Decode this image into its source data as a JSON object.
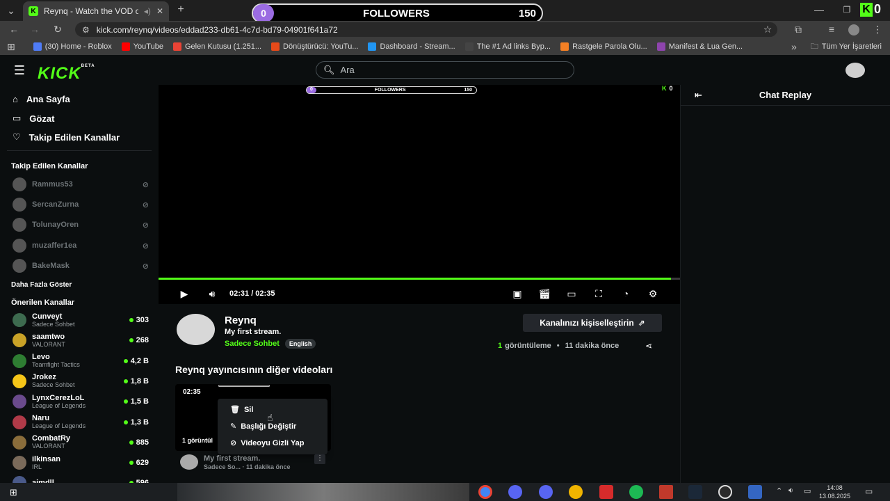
{
  "browser": {
    "tab_title": "Reynq - Watch the VOD on",
    "url": "kick.com/reynq/videos/eddad233-db61-4c7d-bd79-04901f641a72",
    "bookmarks": [
      {
        "label": "(30) Home - Roblox",
        "color": "#4f7cf7"
      },
      {
        "label": "YouTube",
        "color": "#ff0000"
      },
      {
        "label": "Gelen Kutusu (1.251...",
        "color": "#ea4335"
      },
      {
        "label": "Dönüştürücü: YouTu...",
        "color": "#e64a19"
      },
      {
        "label": "Dashboard - Stream...",
        "color": "#2196f3"
      },
      {
        "label": "The #1 Ad links Byp...",
        "color": "#444444"
      },
      {
        "label": "Rastgele Parola Olu...",
        "color": "#f48024"
      },
      {
        "label": "Manifest & Lua Gen...",
        "color": "#8e44ad"
      }
    ],
    "all_bookmarks": "Tüm Yer İşaretleri"
  },
  "overlay": {
    "followers_label": "FOLLOWERS",
    "followers_current": "0",
    "followers_goal": "150",
    "kick_count": "0"
  },
  "header": {
    "logo": "KICK",
    "logo_badge": "BETA",
    "search_placeholder": "Ara"
  },
  "sidebar": {
    "nav": [
      {
        "label": "Ana Sayfa",
        "icon": "home-icon"
      },
      {
        "label": "Gözat",
        "icon": "browse-icon"
      },
      {
        "label": "Takip Edilen Kanallar",
        "icon": "heart-icon"
      }
    ],
    "followed_title": "Takip Edilen Kanallar",
    "followed": [
      "Rammus53",
      "SercanZurna",
      "TolunayOren",
      "muzaffer1ea",
      "BakeMask"
    ],
    "show_more": "Daha Fazla Göster",
    "recommended_title": "Önerilen Kanallar",
    "recommended": [
      {
        "name": "Cunveyt",
        "category": "Sadece Sohbet",
        "viewers": "303",
        "color": "#3d6b4f"
      },
      {
        "name": "saamtwo",
        "category": "VALORANT",
        "viewers": "268",
        "color": "#c9a227"
      },
      {
        "name": "Levo",
        "category": "Teamfight Tactics",
        "viewers": "4,2 B",
        "color": "#2e7d32"
      },
      {
        "name": "Jrokez",
        "category": "Sadece Sohbet",
        "viewers": "1,8 B",
        "color": "#f5c518"
      },
      {
        "name": "LynxCerezLoL",
        "category": "League of Legends",
        "viewers": "1,5 B",
        "color": "#6a4a8c"
      },
      {
        "name": "Naru",
        "category": "League of Legends",
        "viewers": "1,3 B",
        "color": "#b03a48"
      },
      {
        "name": "CombatRy",
        "category": "VALORANT",
        "viewers": "885",
        "color": "#8a6d3b"
      },
      {
        "name": "ilkinsan",
        "category": "IRL",
        "viewers": "629",
        "color": "#7a6a5a"
      },
      {
        "name": "aimdll",
        "category": "",
        "viewers": "596",
        "color": "#4a5a8a"
      }
    ]
  },
  "player": {
    "time": "02:31 / 02:35",
    "progress": 0.982
  },
  "chat": {
    "title": "Chat Replay"
  },
  "video": {
    "streamer": "Reynq",
    "title": "My first stream.",
    "category": "Sadece Sohbet",
    "language": "English",
    "customize_button": "Kanalınızı kişiselleştirin",
    "views_count": "1",
    "views_label": "görüntüleme",
    "time_ago": "11 dakika önce"
  },
  "other_videos": {
    "heading": "Reynq yayıncısının diğer videoları",
    "card": {
      "duration": "02:35",
      "views": "1 görüntül",
      "title": "My first stream.",
      "meta": "Sadece So... · 11 dakika önce"
    },
    "menu": [
      "Sil",
      "Başlığı Değiştir",
      "Videoyu Gizli Yap"
    ]
  },
  "taskbar": {
    "time": "14:08",
    "date": "13.08.2025"
  }
}
